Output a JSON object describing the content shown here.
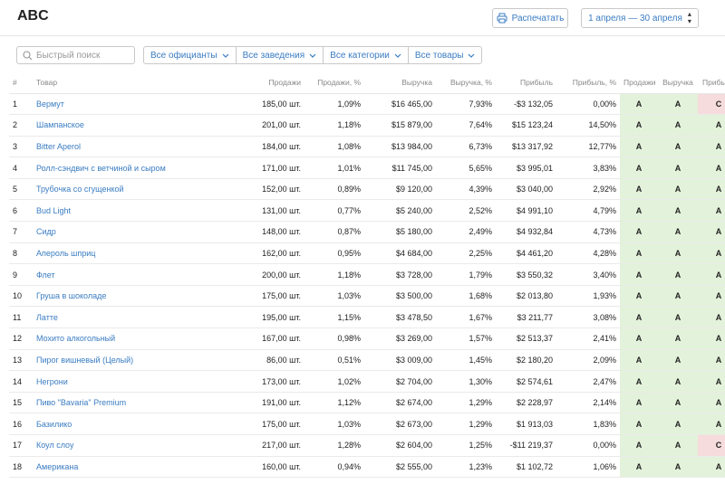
{
  "header": {
    "title": "ABC",
    "print_label": "Распечатать",
    "date_range": "1 апреля — 30 апреля"
  },
  "toolbar": {
    "search_placeholder": "Быстрый поиск",
    "filters": [
      {
        "label": "Все официанты"
      },
      {
        "label": "Все заведения"
      },
      {
        "label": "Все категории"
      },
      {
        "label": "Все товары"
      }
    ]
  },
  "table": {
    "columns": [
      "#",
      "Товар",
      "Продажи",
      "Продажи, %",
      "Выручка",
      "Выручка, %",
      "Прибыль",
      "Прибыль, %",
      "Продажи",
      "Выручка",
      "Прибыль"
    ],
    "rows": [
      {
        "n": "1",
        "name": "Вермут",
        "sales": "185,00 шт.",
        "sales_pct": "1,09%",
        "revenue": "$16 465,00",
        "revenue_pct": "7,93%",
        "profit": "-$3 132,05",
        "profit_pct": "0,00%",
        "g_sales": "A",
        "g_revenue": "A",
        "g_profit": "C"
      },
      {
        "n": "2",
        "name": "Шампанское",
        "sales": "201,00 шт.",
        "sales_pct": "1,18%",
        "revenue": "$15 879,00",
        "revenue_pct": "7,64%",
        "profit": "$15 123,24",
        "profit_pct": "14,50%",
        "g_sales": "A",
        "g_revenue": "A",
        "g_profit": "A"
      },
      {
        "n": "3",
        "name": "Bitter Aperol",
        "sales": "184,00 шт.",
        "sales_pct": "1,08%",
        "revenue": "$13 984,00",
        "revenue_pct": "6,73%",
        "profit": "$13 317,92",
        "profit_pct": "12,77%",
        "g_sales": "A",
        "g_revenue": "A",
        "g_profit": "A"
      },
      {
        "n": "4",
        "name": "Ролл-сэндвич с ветчиной и сыром",
        "sales": "171,00 шт.",
        "sales_pct": "1,01%",
        "revenue": "$11 745,00",
        "revenue_pct": "5,65%",
        "profit": "$3 995,01",
        "profit_pct": "3,83%",
        "g_sales": "A",
        "g_revenue": "A",
        "g_profit": "A"
      },
      {
        "n": "5",
        "name": "Трубочка со сгущенкой",
        "sales": "152,00 шт.",
        "sales_pct": "0,89%",
        "revenue": "$9 120,00",
        "revenue_pct": "4,39%",
        "profit": "$3 040,00",
        "profit_pct": "2,92%",
        "g_sales": "A",
        "g_revenue": "A",
        "g_profit": "A"
      },
      {
        "n": "6",
        "name": "Bud Light",
        "sales": "131,00 шт.",
        "sales_pct": "0,77%",
        "revenue": "$5 240,00",
        "revenue_pct": "2,52%",
        "profit": "$4 991,10",
        "profit_pct": "4,79%",
        "g_sales": "A",
        "g_revenue": "A",
        "g_profit": "A"
      },
      {
        "n": "7",
        "name": "Сидр",
        "sales": "148,00 шт.",
        "sales_pct": "0,87%",
        "revenue": "$5 180,00",
        "revenue_pct": "2,49%",
        "profit": "$4 932,84",
        "profit_pct": "4,73%",
        "g_sales": "A",
        "g_revenue": "A",
        "g_profit": "A"
      },
      {
        "n": "8",
        "name": "Апероль шприц",
        "sales": "162,00 шт.",
        "sales_pct": "0,95%",
        "revenue": "$4 684,00",
        "revenue_pct": "2,25%",
        "profit": "$4 461,20",
        "profit_pct": "4,28%",
        "g_sales": "A",
        "g_revenue": "A",
        "g_profit": "A"
      },
      {
        "n": "9",
        "name": "Флет",
        "sales": "200,00 шт.",
        "sales_pct": "1,18%",
        "revenue": "$3 728,00",
        "revenue_pct": "1,79%",
        "profit": "$3 550,32",
        "profit_pct": "3,40%",
        "g_sales": "A",
        "g_revenue": "A",
        "g_profit": "A"
      },
      {
        "n": "10",
        "name": "Груша в шоколаде",
        "sales": "175,00 шт.",
        "sales_pct": "1,03%",
        "revenue": "$3 500,00",
        "revenue_pct": "1,68%",
        "profit": "$2 013,80",
        "profit_pct": "1,93%",
        "g_sales": "A",
        "g_revenue": "A",
        "g_profit": "A"
      },
      {
        "n": "11",
        "name": "Латте",
        "sales": "195,00 шт.",
        "sales_pct": "1,15%",
        "revenue": "$3 478,50",
        "revenue_pct": "1,67%",
        "profit": "$3 211,77",
        "profit_pct": "3,08%",
        "g_sales": "A",
        "g_revenue": "A",
        "g_profit": "A"
      },
      {
        "n": "12",
        "name": "Мохито алкогольный",
        "sales": "167,00 шт.",
        "sales_pct": "0,98%",
        "revenue": "$3 269,00",
        "revenue_pct": "1,57%",
        "profit": "$2 513,37",
        "profit_pct": "2,41%",
        "g_sales": "A",
        "g_revenue": "A",
        "g_profit": "A"
      },
      {
        "n": "13",
        "name": "Пирог вишневый (Целый)",
        "sales": "86,00 шт.",
        "sales_pct": "0,51%",
        "revenue": "$3 009,00",
        "revenue_pct": "1,45%",
        "profit": "$2 180,20",
        "profit_pct": "2,09%",
        "g_sales": "A",
        "g_revenue": "A",
        "g_profit": "A"
      },
      {
        "n": "14",
        "name": "Негрони",
        "sales": "173,00 шт.",
        "sales_pct": "1,02%",
        "revenue": "$2 704,00",
        "revenue_pct": "1,30%",
        "profit": "$2 574,61",
        "profit_pct": "2,47%",
        "g_sales": "A",
        "g_revenue": "A",
        "g_profit": "A"
      },
      {
        "n": "15",
        "name": "Пиво \"Bavaria\" Premium",
        "sales": "191,00 шт.",
        "sales_pct": "1,12%",
        "revenue": "$2 674,00",
        "revenue_pct": "1,29%",
        "profit": "$2 228,97",
        "profit_pct": "2,14%",
        "g_sales": "A",
        "g_revenue": "A",
        "g_profit": "A"
      },
      {
        "n": "16",
        "name": "Базилико",
        "sales": "175,00 шт.",
        "sales_pct": "1,03%",
        "revenue": "$2 673,00",
        "revenue_pct": "1,29%",
        "profit": "$1 913,03",
        "profit_pct": "1,83%",
        "g_sales": "A",
        "g_revenue": "A",
        "g_profit": "A"
      },
      {
        "n": "17",
        "name": "Коул слоу",
        "sales": "217,00 шт.",
        "sales_pct": "1,28%",
        "revenue": "$2 604,00",
        "revenue_pct": "1,25%",
        "profit": "-$11 219,37",
        "profit_pct": "0,00%",
        "g_sales": "A",
        "g_revenue": "A",
        "g_profit": "C"
      },
      {
        "n": "18",
        "name": "Американа",
        "sales": "160,00 шт.",
        "sales_pct": "0,94%",
        "revenue": "$2 555,00",
        "revenue_pct": "1,23%",
        "profit": "$1 102,72",
        "profit_pct": "1,06%",
        "g_sales": "A",
        "g_revenue": "A",
        "g_profit": "A"
      }
    ]
  },
  "colors": {
    "link": "#3a7cc2",
    "grade_a_bg": "#e3f2da",
    "grade_c_bg": "#f6dcdc"
  },
  "icons": {
    "print": "printer-icon",
    "search": "search-icon",
    "dropdown": "chevron-down-icon",
    "date": "up-down-arrows-icon"
  }
}
